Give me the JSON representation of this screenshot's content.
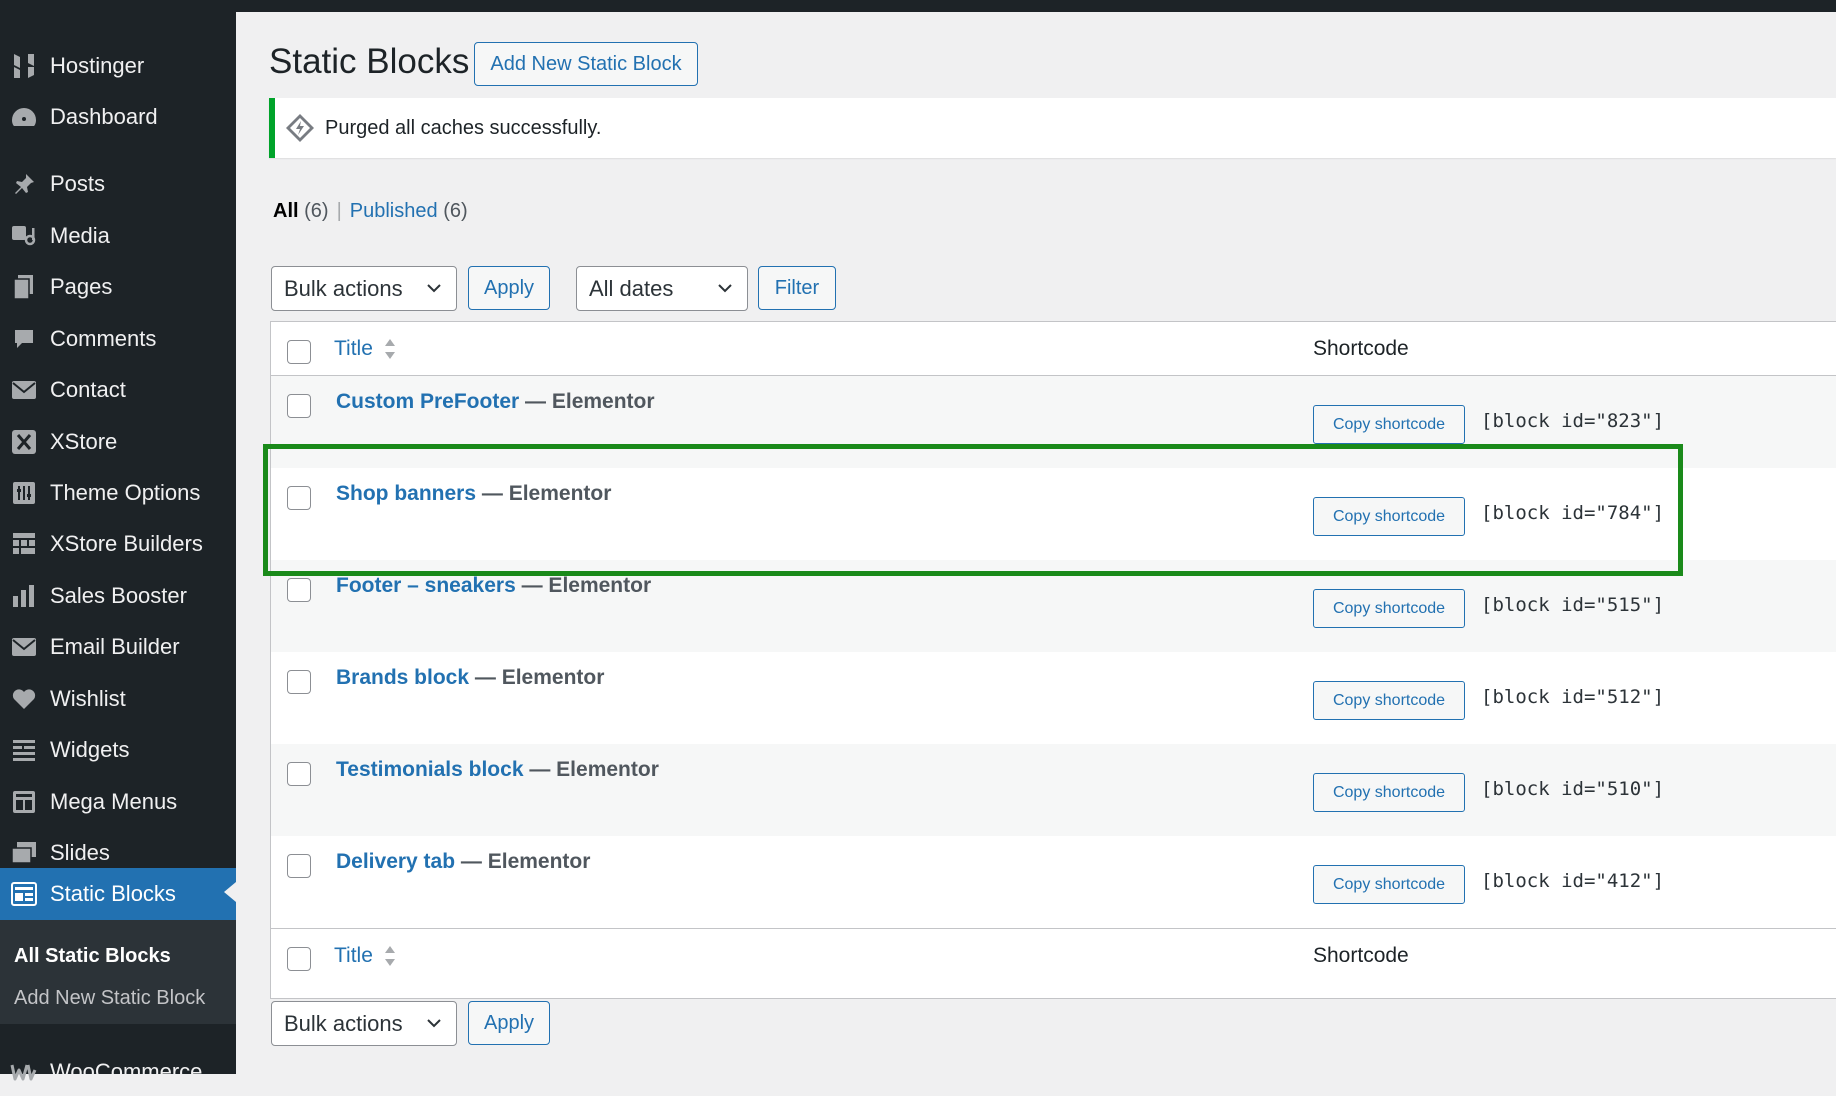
{
  "sidebar": {
    "items": [
      {
        "label": "Hostinger",
        "icon": "hostinger-icon"
      },
      {
        "label": "Dashboard",
        "icon": "dashboard-icon"
      },
      {
        "label": "Posts",
        "icon": "pin-icon"
      },
      {
        "label": "Media",
        "icon": "media-icon"
      },
      {
        "label": "Pages",
        "icon": "pages-icon"
      },
      {
        "label": "Comments",
        "icon": "comment-icon"
      },
      {
        "label": "Contact",
        "icon": "envelope-icon"
      },
      {
        "label": "XStore",
        "icon": "xstore-icon"
      },
      {
        "label": "Theme Options",
        "icon": "theme-options-icon"
      },
      {
        "label": "XStore Builders",
        "icon": "builders-icon"
      },
      {
        "label": "Sales Booster",
        "icon": "bar-chart-icon"
      },
      {
        "label": "Email Builder",
        "icon": "envelope-icon"
      },
      {
        "label": "Wishlist",
        "icon": "heart-icon"
      },
      {
        "label": "Widgets",
        "icon": "widgets-icon"
      },
      {
        "label": "Mega Menus",
        "icon": "mega-menu-icon"
      },
      {
        "label": "Slides",
        "icon": "slides-icon"
      },
      {
        "label": "Static Blocks",
        "icon": "static-blocks-icon"
      },
      {
        "label": "WooCommerce",
        "icon": "woocommerce-icon"
      }
    ],
    "submenu": {
      "all": "All Static Blocks",
      "add_new": "Add New Static Block"
    }
  },
  "header": {
    "title": "Static Blocks",
    "add_new_label": "Add New Static Block"
  },
  "notice": {
    "text": "Purged all caches successfully."
  },
  "views": {
    "all_label": "All",
    "all_count": "(6)",
    "separator": "|",
    "published_label": "Published",
    "published_count": "(6)"
  },
  "filters": {
    "bulk_actions": "Bulk actions",
    "apply": "Apply",
    "dates": "All dates",
    "filter": "Filter"
  },
  "table": {
    "col_title": "Title",
    "col_shortcode": "Shortcode",
    "rows": [
      {
        "title": "Custom PreFooter",
        "state": " — Elementor",
        "button": "Copy shortcode",
        "shortcode": "[block id=\"823\"]"
      },
      {
        "title": "Shop banners",
        "state": " — Elementor",
        "button": "Copy shortcode",
        "shortcode": "[block id=\"784\"]"
      },
      {
        "title": "Footer – sneakers",
        "state": " — Elementor",
        "button": "Copy shortcode",
        "shortcode": "[block id=\"515\"]"
      },
      {
        "title": "Brands block",
        "state": " — Elementor",
        "button": "Copy shortcode",
        "shortcode": "[block id=\"512\"]"
      },
      {
        "title": "Testimonials block",
        "state": " — Elementor",
        "button": "Copy shortcode",
        "shortcode": "[block id=\"510\"]"
      },
      {
        "title": "Delivery tab",
        "state": " — Elementor",
        "button": "Copy shortcode",
        "shortcode": "[block id=\"412\"]"
      }
    ]
  },
  "bottom_filters": {
    "bulk_actions": "Bulk actions",
    "apply": "Apply"
  },
  "colors": {
    "accent": "#2271b1",
    "sidebar_bg": "#1d2327",
    "notice_border": "#00a32a",
    "highlight": "#1a8a1a"
  }
}
